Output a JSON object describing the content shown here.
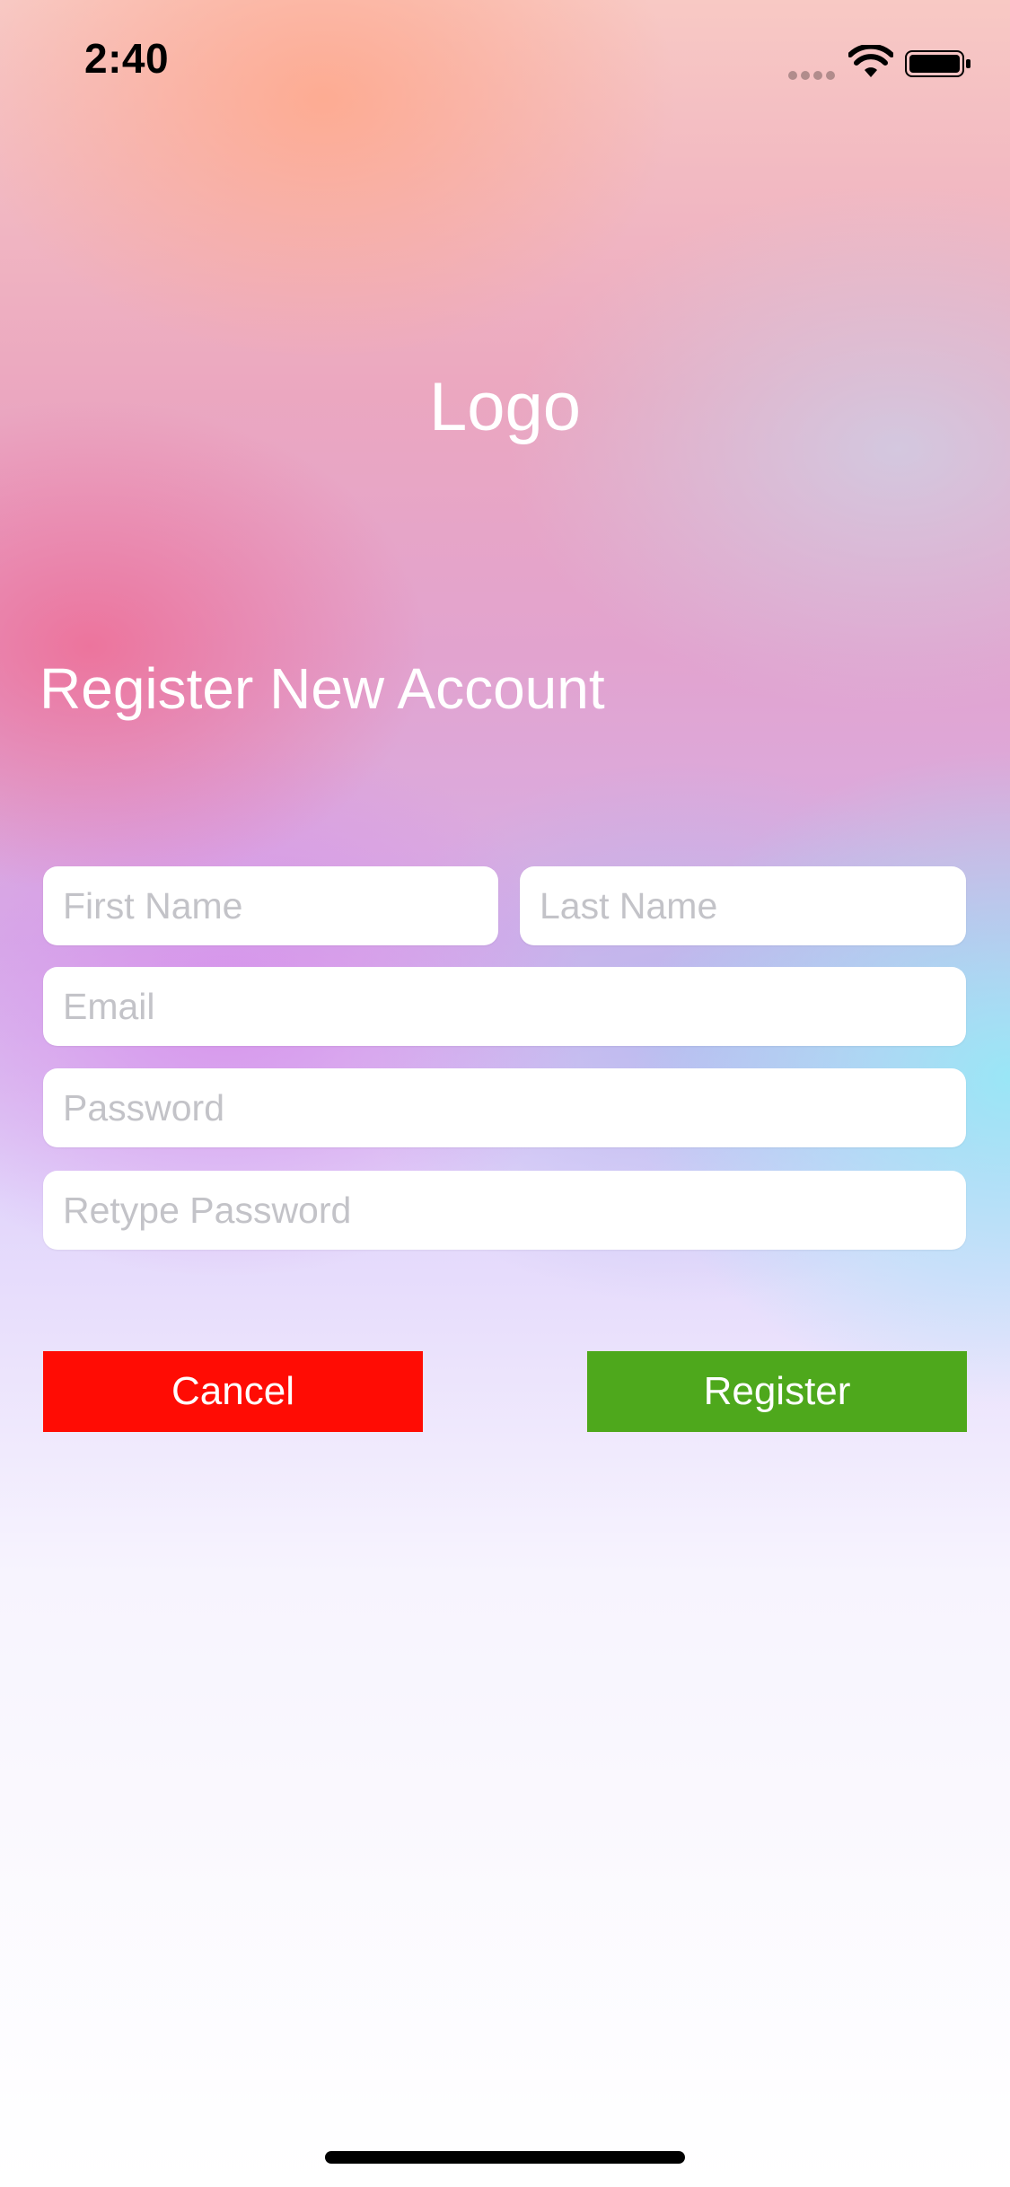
{
  "status_bar": {
    "time": "2:40"
  },
  "header": {
    "logo_text": "Logo",
    "title": "Register New Account"
  },
  "form": {
    "first_name": {
      "placeholder": "First Name",
      "value": ""
    },
    "last_name": {
      "placeholder": "Last Name",
      "value": ""
    },
    "email": {
      "placeholder": "Email",
      "value": ""
    },
    "password": {
      "placeholder": "Password",
      "value": ""
    },
    "retype_password": {
      "placeholder": "Retype Password",
      "value": ""
    }
  },
  "actions": {
    "cancel_label": "Cancel",
    "register_label": "Register"
  },
  "colors": {
    "cancel": "#ff0c04",
    "register": "#4ea81c"
  },
  "icons": {
    "signal": "signal-dots-icon",
    "wifi": "wifi-icon",
    "battery": "battery-icon"
  }
}
